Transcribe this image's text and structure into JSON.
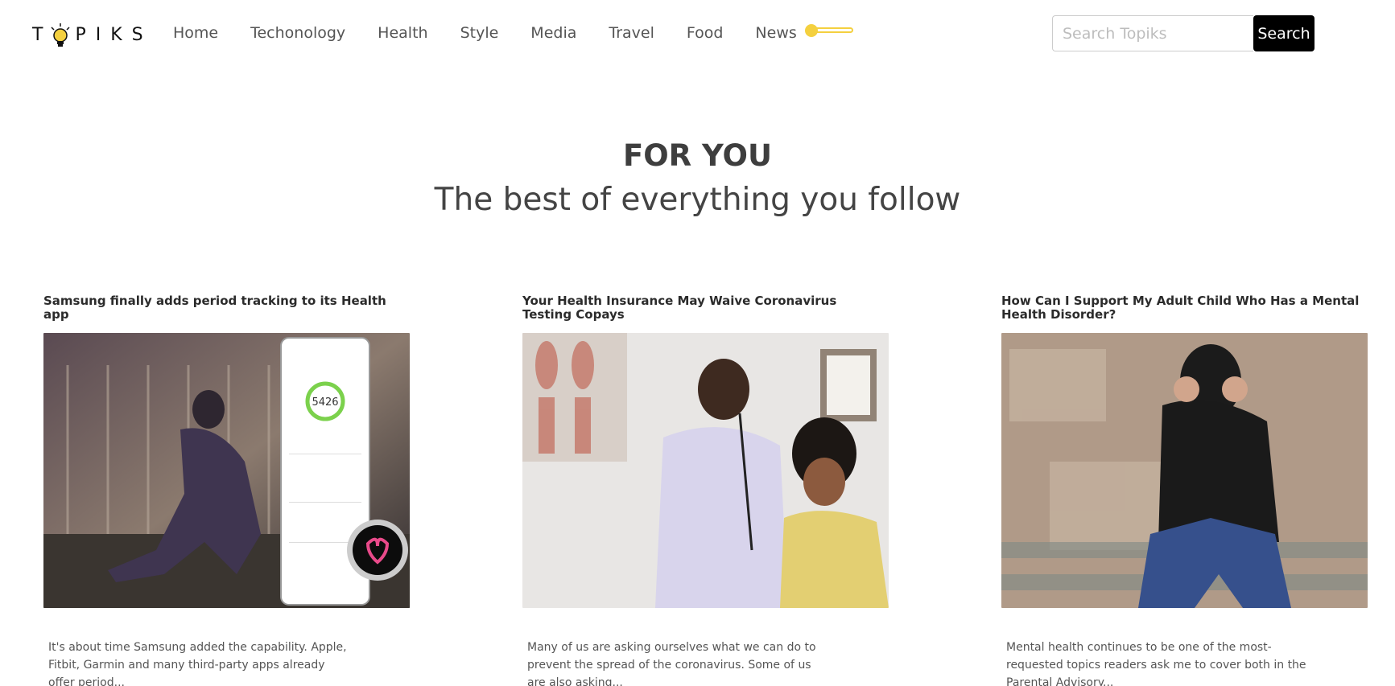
{
  "header": {
    "logo_text": "TOPIKS",
    "nav": [
      "Home",
      "Techonology",
      "Health",
      "Style",
      "Media",
      "Travel",
      "Food",
      "News"
    ],
    "search_placeholder": "Search Topiks",
    "search_button": "Search",
    "accent_color": "#f4d03f"
  },
  "hero": {
    "title": "FOR YOU",
    "subtitle": "The best of everything you follow"
  },
  "articles": [
    {
      "title": "Samsung finally adds period tracking to its Health app",
      "excerpt": "It's about time Samsung added the capability. Apple, Fitbit, Garmin and many third-party apps already offer period...",
      "image_icon": "samsung-health-photo"
    },
    {
      "title": "Your Health Insurance May Waive Coronavirus Testing Copays",
      "excerpt": "Many of us are asking ourselves what we can do to prevent the spread of the coronavirus. Some of us are also asking...",
      "image_icon": "doctor-patient-photo"
    },
    {
      "title": "How Can I Support My Adult Child Who Has a Mental Health Disorder?",
      "excerpt": "Mental health continues to be one of the most-requested topics readers ask me to cover both in the Parental Advisory...",
      "image_icon": "distressed-person-photo"
    }
  ]
}
